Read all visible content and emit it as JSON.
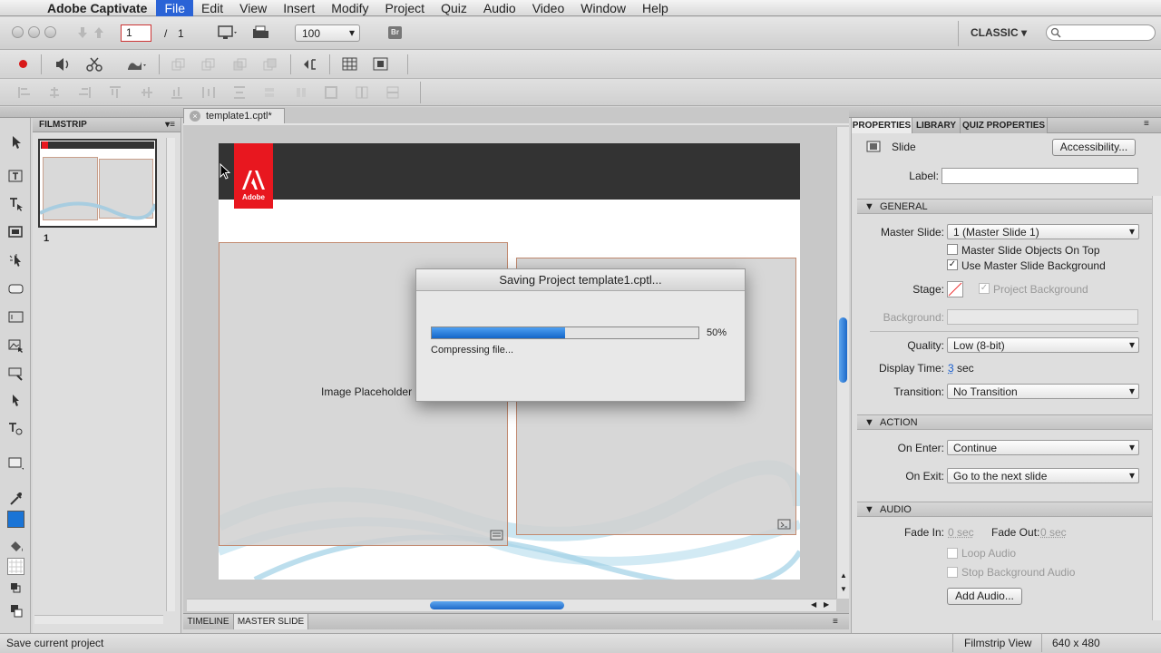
{
  "app_name": "Adobe Captivate",
  "menu": [
    "File",
    "Edit",
    "View",
    "Insert",
    "Modify",
    "Project",
    "Quiz",
    "Audio",
    "Video",
    "Window",
    "Help"
  ],
  "toolbar": {
    "page_current": "1",
    "page_sep": "/",
    "page_total": "1",
    "zoom": "100",
    "bridge_label": "Br",
    "workspace": "CLASSIC"
  },
  "filmstrip": {
    "title": "FILMSTRIP",
    "slides": [
      {
        "number": "1"
      }
    ]
  },
  "document": {
    "tab_title": "template1.cptl*"
  },
  "stage": {
    "logo_text": "Adobe",
    "image_placeholder": "Image Placeholder"
  },
  "dialog": {
    "title": "Saving Project template1.cptl...",
    "progress": 0.5,
    "percent_label": "50%",
    "status": "Compressing file..."
  },
  "properties": {
    "tabs": [
      "PROPERTIES",
      "LIBRARY",
      "QUIZ PROPERTIES"
    ],
    "object_type": "Slide",
    "accessibility_button": "Accessibility...",
    "label_caption": "Label:",
    "label_value": "",
    "general": {
      "title": "GENERAL",
      "master_slide_label": "Master Slide:",
      "master_slide_value": "1 (Master Slide 1)",
      "objects_on_top_label": "Master Slide Objects On Top",
      "objects_on_top_checked": false,
      "use_background_label": "Use Master Slide Background",
      "use_background_checked": true,
      "stage_label": "Stage:",
      "project_background_label": "Project Background",
      "background_label": "Background:",
      "quality_label": "Quality:",
      "quality_value": "Low (8-bit)",
      "display_time_label": "Display Time:",
      "display_time_value": "3",
      "display_time_unit": "sec",
      "transition_label": "Transition:",
      "transition_value": "No Transition"
    },
    "action": {
      "title": "ACTION",
      "on_enter_label": "On Enter:",
      "on_enter_value": "Continue",
      "on_exit_label": "On Exit:",
      "on_exit_value": "Go to the next slide"
    },
    "audio": {
      "title": "AUDIO",
      "fade_in_label": "Fade In:",
      "fade_in_value": "0 sec",
      "fade_out_label": "Fade Out:",
      "fade_out_value": "0 sec",
      "loop_audio_label": "Loop Audio",
      "stop_bg_audio_label": "Stop Background Audio",
      "add_audio_button": "Add Audio..."
    }
  },
  "bottom_tabs": [
    "TIMELINE",
    "MASTER SLIDE"
  ],
  "status_bar": {
    "message": "Save current project",
    "view": "Filmstrip View",
    "dimensions": "640 x 480"
  },
  "colors": {
    "accent": "#1a74d6",
    "adobe_red": "#e8171f",
    "stage_header": "#333333",
    "menu_active": "#2a63d6"
  }
}
